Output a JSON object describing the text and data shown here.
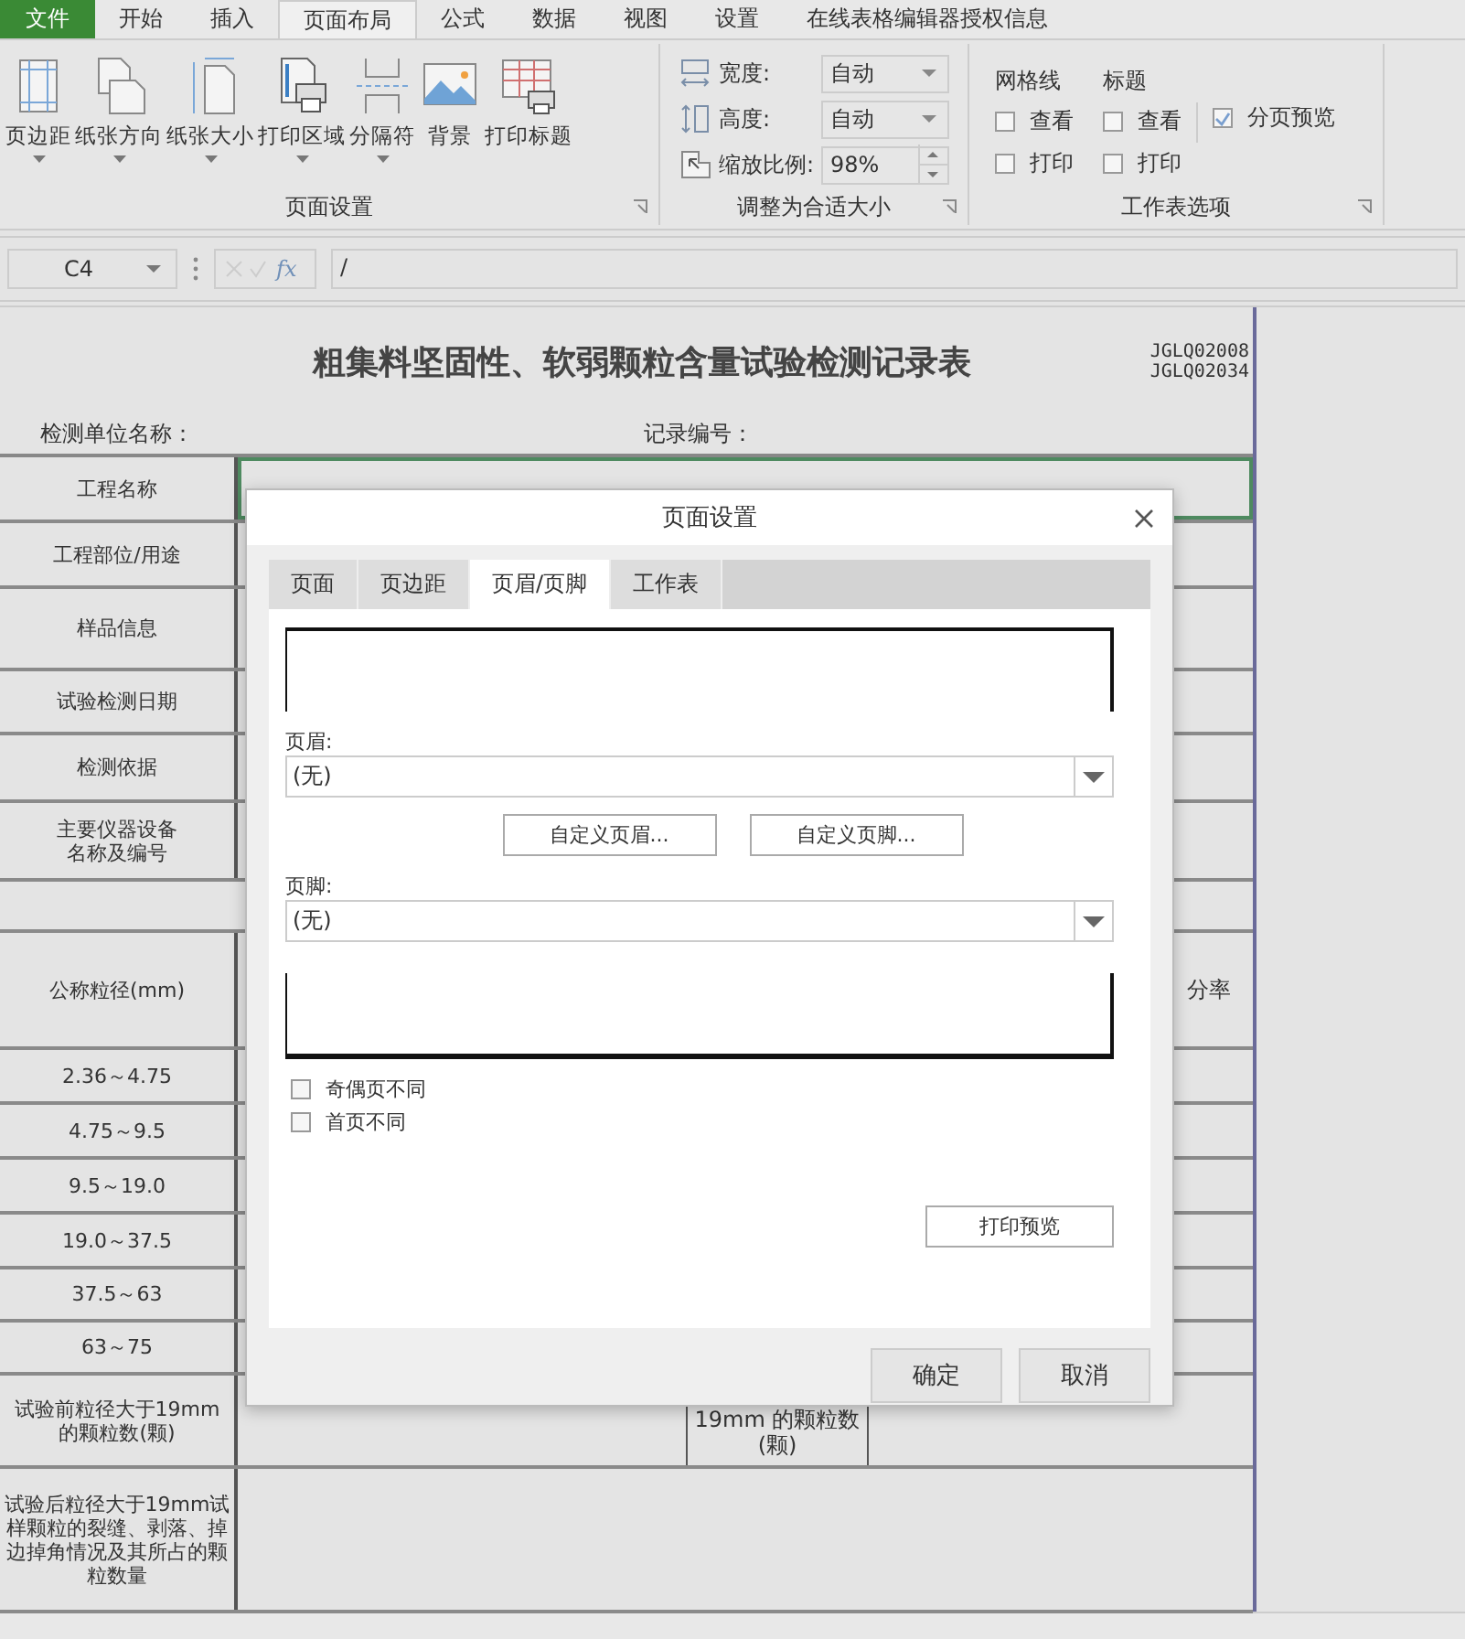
{
  "menu_tabs": [
    {
      "label": "文件",
      "kind": "file",
      "selected": false
    },
    {
      "label": "开始",
      "kind": "tab",
      "selected": false
    },
    {
      "label": "插入",
      "kind": "tab",
      "selected": false
    },
    {
      "label": "页面布局",
      "kind": "tab",
      "selected": true
    },
    {
      "label": "公式",
      "kind": "tab",
      "selected": false
    },
    {
      "label": "数据",
      "kind": "tab",
      "selected": false
    },
    {
      "label": "视图",
      "kind": "tab",
      "selected": false
    },
    {
      "label": "设置",
      "kind": "tab",
      "selected": false
    },
    {
      "label": "在线表格编辑器授权信息",
      "kind": "tab",
      "selected": false
    }
  ],
  "page_setup_group": {
    "title": "页面设置",
    "buttons": [
      {
        "label": "页边距",
        "kind": "margins",
        "dropdown": true
      },
      {
        "label": "纸张方向",
        "kind": "orientation",
        "dropdown": true
      },
      {
        "label": "纸张大小",
        "kind": "size",
        "dropdown": true
      },
      {
        "label": "打印区域",
        "kind": "print_area",
        "dropdown": true
      },
      {
        "label": "分隔符",
        "kind": "breaks",
        "dropdown": true
      },
      {
        "label": "背景",
        "kind": "background",
        "dropdown": false
      },
      {
        "label": "打印标题",
        "kind": "print_titles",
        "dropdown": false
      }
    ]
  },
  "scale_group": {
    "title": "调整为合适大小",
    "rows": [
      {
        "label": "宽度:",
        "kind": "width",
        "value": "自动"
      },
      {
        "label": "高度:",
        "kind": "height",
        "value": "自动"
      },
      {
        "label": "缩放比例:",
        "kind": "scale",
        "value": "98%"
      }
    ]
  },
  "sheet_options_group": {
    "title": "工作表选项",
    "sections": [
      {
        "heading": "网格线",
        "view": {
          "label": "查看",
          "checked": false
        },
        "print": {
          "label": "打印",
          "checked": false
        }
      },
      {
        "heading": "标题",
        "view": {
          "label": "查看",
          "checked": false
        },
        "print": {
          "label": "打印",
          "checked": false
        }
      }
    ],
    "page_break_preview": {
      "label": "分页预览",
      "checked": true
    }
  },
  "formula_bar": {
    "name_box": "C4",
    "fx": "fx",
    "formula": "/"
  },
  "sheet": {
    "title": "粗集料坚固性、软弱颗粒含量试验检测记录表",
    "codes": [
      "JGLQ02008",
      "JGLQ02034"
    ],
    "unit_label": "检测单位名称：",
    "record_label": "记录编号：",
    "rows": [
      {
        "kind": "label",
        "label": "工程名称",
        "selected": true
      },
      {
        "kind": "label",
        "label": "工程部位/用途",
        "selected": false
      },
      {
        "kind": "label",
        "label": "样品信息",
        "selected": false
      },
      {
        "kind": "label",
        "label": "试验检测日期",
        "selected": false
      },
      {
        "kind": "label",
        "label": "检测依据",
        "selected": false
      },
      {
        "kind": "label",
        "label": "主要仪器设备名称及编号",
        "selected": false
      },
      {
        "kind": "blank",
        "selected": false
      },
      {
        "kind": "label",
        "label": "公称粒径(mm)",
        "right_text": "分率",
        "selected": false
      },
      {
        "kind": "label",
        "label": "2.36～4.75",
        "selected": false
      },
      {
        "kind": "label",
        "label": "4.75～9.5",
        "selected": false
      },
      {
        "kind": "label",
        "label": "9.5～19.0",
        "selected": false
      },
      {
        "kind": "label",
        "label": "19.0～37.5",
        "selected": false
      },
      {
        "kind": "label",
        "label": "37.5～63",
        "selected": false
      },
      {
        "kind": "label",
        "label": "63～75",
        "selected": false
      },
      {
        "kind": "split",
        "label": "试验前粒径大于19mm 的颗粒数(颗)",
        "extra": "19mm 的颗粒数\n(颗)",
        "selected": false
      },
      {
        "kind": "label",
        "label": "试验后粒径大于19mm试样颗粒的裂缝、剥落、掉边掉角情况及其所占的颗粒数量",
        "selected": false
      }
    ]
  },
  "dialog": {
    "title": "页面设置",
    "tabs": [
      {
        "label": "页面",
        "selected": false
      },
      {
        "label": "页边距",
        "selected": false
      },
      {
        "label": "页眉/页脚",
        "selected": true
      },
      {
        "label": "工作表",
        "selected": false
      }
    ],
    "header_label": "页眉:",
    "header_value": "(无)",
    "custom_header": "自定义页眉...",
    "custom_footer": "自定义页脚...",
    "footer_label": "页脚:",
    "footer_value": "(无)",
    "options": [
      {
        "label": "奇偶页不同",
        "checked": false
      },
      {
        "label": "首页不同",
        "checked": false
      }
    ],
    "print_preview": "打印预览",
    "ok": "确定",
    "cancel": "取消"
  }
}
